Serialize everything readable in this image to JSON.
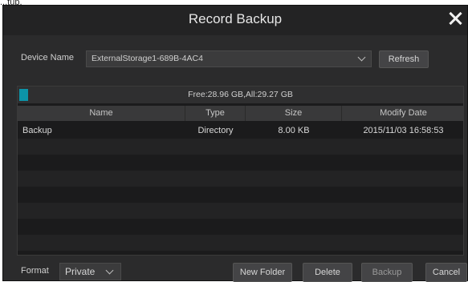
{
  "top_fragment": "...tup.",
  "dialog": {
    "title": "Record Backup",
    "close_icon": "close-icon"
  },
  "device": {
    "label": "Device Name",
    "selected": "ExternalStorage1-689B-4AC4",
    "refresh_label": "Refresh"
  },
  "storage": {
    "text": "Free:28.96 GB,All:29.27 GB",
    "used_fraction": 0.01
  },
  "table": {
    "columns": [
      "Name",
      "Type",
      "Size",
      "Modify Date"
    ],
    "rows": [
      {
        "name": "Backup",
        "type": "Directory",
        "size": "8.00 KB",
        "date": "2015/11/03 16:58:53"
      }
    ],
    "empty_rows": 7
  },
  "footer": {
    "format_label": "Format",
    "format_value": "Private",
    "new_folder_label": "New Folder",
    "delete_label": "Delete",
    "backup_label": "Backup",
    "cancel_label": "Cancel"
  },
  "colors": {
    "dialog_bg": "#2b2b2c",
    "accent": "#0c94a8"
  }
}
